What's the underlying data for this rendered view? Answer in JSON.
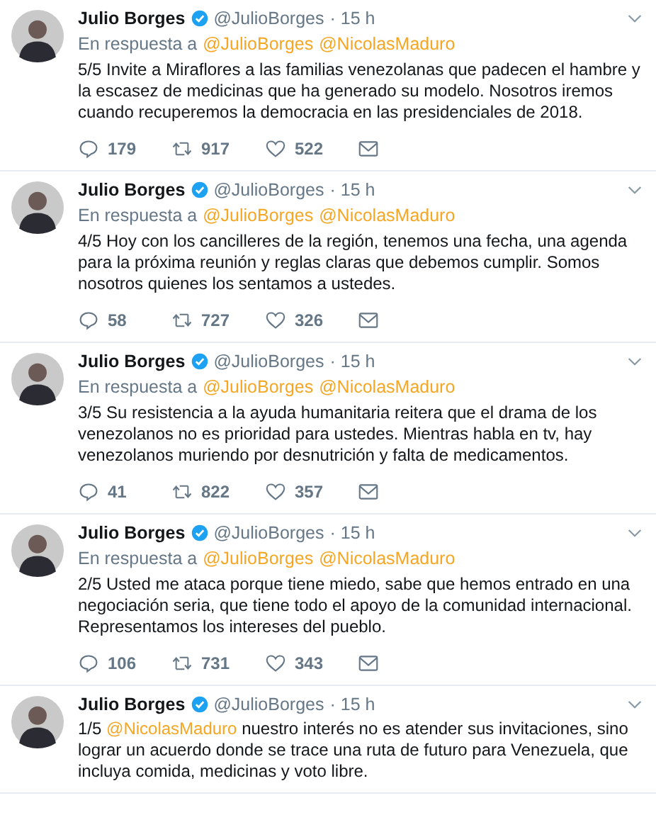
{
  "tweets": [
    {
      "name": "Julio Borges",
      "verified": true,
      "handle": "@JulioBorges",
      "time": "· 15 h",
      "reply_label": "En respuesta a",
      "reply_to": [
        "@JulioBorges",
        "@NicolasMaduro"
      ],
      "text": [
        {
          "kind": "text",
          "text": "5/5 Invite a Miraflores a las familias venezolanas que padecen el hambre y la escasez de medicinas que ha generado su modelo. Nosotros iremos cuando recuperemos la democracia en las presidenciales de 2018."
        }
      ],
      "replies": "179",
      "retweets": "917",
      "likes": "522"
    },
    {
      "name": "Julio Borges",
      "verified": true,
      "handle": "@JulioBorges",
      "time": "· 15 h",
      "reply_label": "En respuesta a",
      "reply_to": [
        "@JulioBorges",
        "@NicolasMaduro"
      ],
      "text": [
        {
          "kind": "text",
          "text": "4/5 Hoy con los cancilleres de la región, tenemos una fecha, una agenda para la próxima reunión y reglas claras que debemos cumplir. Somos nosotros quienes los sentamos a ustedes."
        }
      ],
      "replies": "58",
      "retweets": "727",
      "likes": "326"
    },
    {
      "name": "Julio Borges",
      "verified": true,
      "handle": "@JulioBorges",
      "time": "· 15 h",
      "reply_label": "En respuesta a",
      "reply_to": [
        "@JulioBorges",
        "@NicolasMaduro"
      ],
      "text": [
        {
          "kind": "text",
          "text": "3/5 Su resistencia a la ayuda humanitaria reitera que el drama de los venezolanos no es prioridad para ustedes. Mientras habla en tv, hay venezolanos muriendo por desnutrición y falta de medicamentos."
        }
      ],
      "replies": "41",
      "retweets": "822",
      "likes": "357"
    },
    {
      "name": "Julio Borges",
      "verified": true,
      "handle": "@JulioBorges",
      "time": "· 15 h",
      "reply_label": "En respuesta a",
      "reply_to": [
        "@JulioBorges",
        "@NicolasMaduro"
      ],
      "text": [
        {
          "kind": "text",
          "text": "2/5 Usted me ataca porque tiene miedo, sabe que hemos entrado en una negociación seria, que tiene todo el apoyo de la comunidad internacional. Representamos los intereses del pueblo."
        }
      ],
      "replies": "106",
      "retweets": "731",
      "likes": "343"
    },
    {
      "name": "Julio Borges",
      "verified": true,
      "handle": "@JulioBorges",
      "time": "· 15 h",
      "text": [
        {
          "kind": "text",
          "text": "1/5 "
        },
        {
          "kind": "mention",
          "text": "@NicolasMaduro"
        },
        {
          "kind": "text",
          "text": " nuestro interés no es atender sus invitaciones, sino lograr un acuerdo donde se trace una ruta de futuro para Venezuela, que incluya comida, medicinas y voto libre."
        }
      ]
    }
  ]
}
